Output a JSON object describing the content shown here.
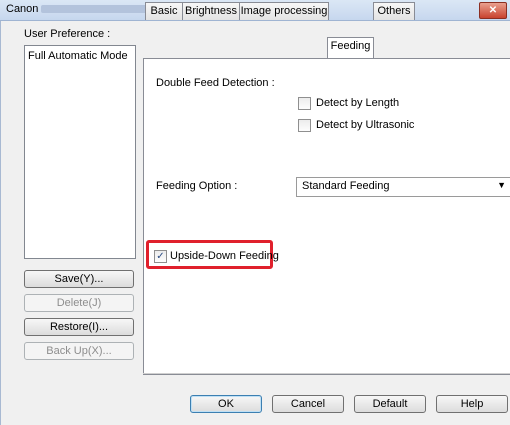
{
  "window": {
    "title_visible": "Canon"
  },
  "left_pane": {
    "header": "User Preference :",
    "list_items": [
      "Full Automatic Mode"
    ],
    "buttons": {
      "save": "Save(Y)...",
      "delete": "Delete(J)",
      "restore": "Restore(I)...",
      "backup": "Back Up(X)..."
    }
  },
  "tabs": [
    {
      "label": "Basic",
      "active": false
    },
    {
      "label": "Brightness",
      "active": false
    },
    {
      "label": "Image processing",
      "active": false
    },
    {
      "label": "Feeding",
      "active": true
    },
    {
      "label": "Others",
      "active": false
    }
  ],
  "feeding_tab": {
    "double_feed_label": "Double Feed Detection :",
    "detect_length": {
      "label": "Detect by Length",
      "checked": false
    },
    "detect_ultrasonic": {
      "label": "Detect by Ultrasonic",
      "checked": false
    },
    "feeding_option_label": "Feeding Option :",
    "feeding_option_value": "Standard Feeding",
    "upside_down": {
      "label": "Upside-Down Feeding",
      "checked": true
    }
  },
  "dialog_buttons": {
    "ok": "OK",
    "cancel": "Cancel",
    "default": "Default",
    "help": "Help"
  },
  "colors": {
    "highlight": "#e0202c",
    "titlebar": "#c6d7ee"
  }
}
